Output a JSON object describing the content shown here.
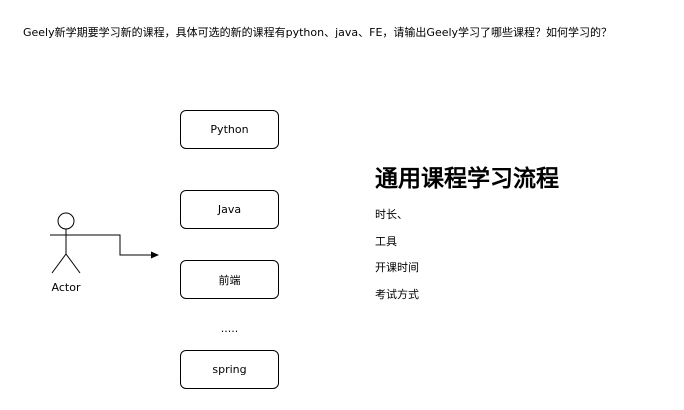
{
  "question": "Geely新学期要学习新的课程，具体可选的新的课程有python、java、FE，请输出Geely学习了哪些课程？如何学习的？",
  "actor": {
    "label": "Actor"
  },
  "courses": [
    {
      "label": "Python"
    },
    {
      "label": "Java"
    },
    {
      "label": "前端"
    },
    {
      "label": "spring"
    }
  ],
  "ellipsis": ".....",
  "process": {
    "title": "通用课程学习流程",
    "items": [
      "时长、",
      "工具",
      "开课时间",
      "考试方式"
    ]
  },
  "colors": {
    "stroke": "#000000",
    "background": "#ffffff"
  }
}
